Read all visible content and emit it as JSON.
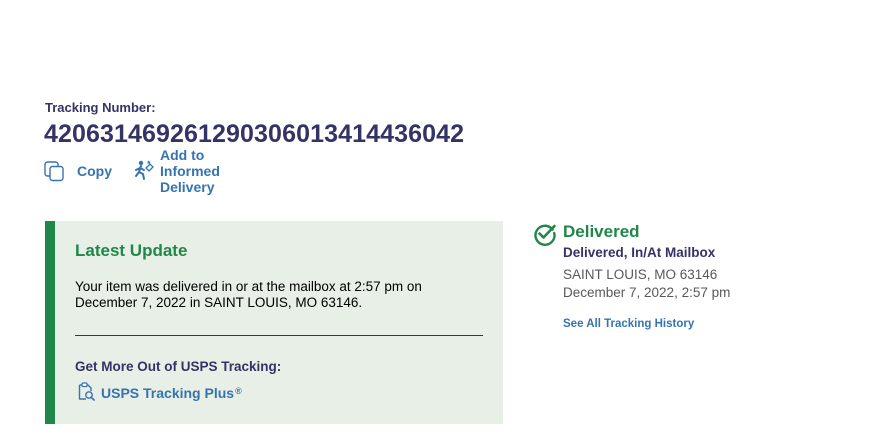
{
  "tracking": {
    "label": "Tracking Number:",
    "number": "420631469261290306013414436042"
  },
  "actions": {
    "copy_label": "Copy",
    "copy_icon": "copy-icon",
    "informed_label": "Add to Informed Delivery",
    "informed_icon": "mail-carrier-icon"
  },
  "latest_update": {
    "title": "Latest Update",
    "text": "Your item was delivered in or at the mailbox at 2:57 pm on December 7, 2022 in SAINT LOUIS, MO 63146.",
    "more_title": "Get More Out of USPS Tracking:",
    "plus_label": "USPS Tracking Plus",
    "plus_mark": "®",
    "plus_icon": "tracking-plus-icon"
  },
  "status": {
    "icon": "check-circle-icon",
    "title": "Delivered",
    "subtitle": "Delivered, In/At Mailbox",
    "location": "SAINT LOUIS, MO 63146",
    "datetime": "December 7, 2022, 2:57 pm",
    "history_link": "See All Tracking History"
  },
  "colors": {
    "navy": "#333366",
    "link_blue": "#3573b1",
    "green": "#218748",
    "panel_bg": "#e8efe7"
  }
}
